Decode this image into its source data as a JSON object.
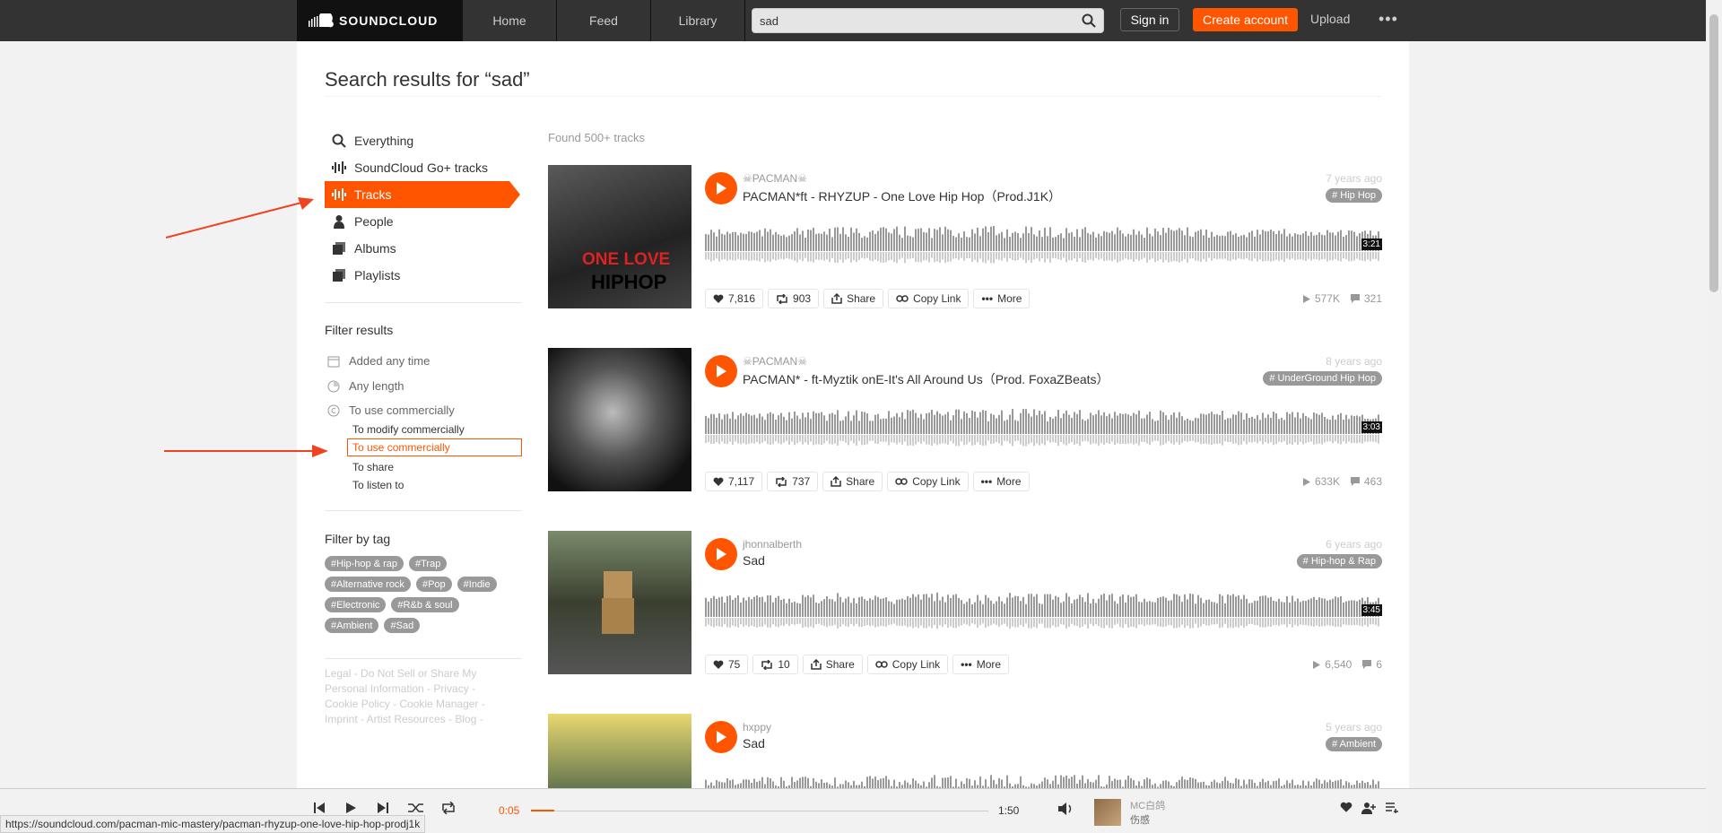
{
  "header": {
    "logo_text": "SOUNDCLOUD",
    "nav": [
      "Home",
      "Feed",
      "Library"
    ],
    "search_value": "sad",
    "sign_in": "Sign in",
    "create_account": "Create account",
    "upload": "Upload",
    "more": "•••"
  },
  "page": {
    "title": "Search results for “sad”"
  },
  "sidebar": {
    "items": [
      {
        "label": "Everything",
        "icon": "search-icon"
      },
      {
        "label": "SoundCloud Go+ tracks",
        "icon": "waveform-icon"
      },
      {
        "label": "Tracks",
        "icon": "waveform-icon",
        "active": true
      },
      {
        "label": "People",
        "icon": "person-icon"
      },
      {
        "label": "Albums",
        "icon": "album-icon"
      },
      {
        "label": "Playlists",
        "icon": "playlist-icon"
      }
    ],
    "filter_title": "Filter results",
    "filters": [
      "Added any time",
      "Any length",
      "To use commercially"
    ],
    "license_options": [
      "To modify commercially",
      "To use commercially",
      "To share",
      "To listen to"
    ],
    "tag_title": "Filter by tag",
    "tags": [
      "Hip-hop & rap",
      "Trap",
      "Alternative rock",
      "Pop",
      "Indie",
      "Electronic",
      "R&b & soul",
      "Ambient",
      "Sad"
    ],
    "footer": "Legal - Do Not Sell or Share My Personal Information - Privacy - Cookie Policy - Cookie Manager - Imprint - Artist Resources - Blog -"
  },
  "results": {
    "found": "Found 500+ tracks"
  },
  "tracks": [
    {
      "user": "☠PACMAN☠",
      "title": "PACMAN*ft - RHYZUP - One Love Hip Hop（Prod.J1K）",
      "age": "7 years ago",
      "genre": "# Hip Hop",
      "duration": "3:21",
      "likes": "7,816",
      "reposts": "903",
      "plays": "577K",
      "comments": "321",
      "art_text": "ONE LOVE",
      "art_text2": "HIPHOP"
    },
    {
      "user": "☠PACMAN☠",
      "title": "PACMAN* - ft-Myztik onE-It's All Around Us（Prod. FoxaZBeats）",
      "age": "8 years ago",
      "genre": "# UnderGround Hip Hop",
      "duration": "3:03",
      "likes": "7,117",
      "reposts": "737",
      "plays": "633K",
      "comments": "463"
    },
    {
      "user": "jhonnalberth",
      "title": "Sad",
      "age": "6 years ago",
      "genre": "# Hip-hop & Rap",
      "duration": "3:45",
      "likes": "75",
      "reposts": "10",
      "plays": "6,540",
      "comments": "6"
    },
    {
      "user": "hxppy",
      "title": "Sad",
      "age": "5 years ago",
      "genre": "# Ambient"
    }
  ],
  "actions": {
    "share": "Share",
    "copy_link": "Copy Link",
    "more": "More"
  },
  "player": {
    "elapsed": "0:05",
    "total": "1:50",
    "progress": 0.05,
    "np_user": "MC白鸽",
    "np_title": "伤感"
  },
  "status_url": "https://soundcloud.com/pacman-mic-mastery/pacman-rhyzup-one-love-hip-hop-prodj1k",
  "colors": {
    "accent": "#ff5500",
    "header": "#333333"
  }
}
